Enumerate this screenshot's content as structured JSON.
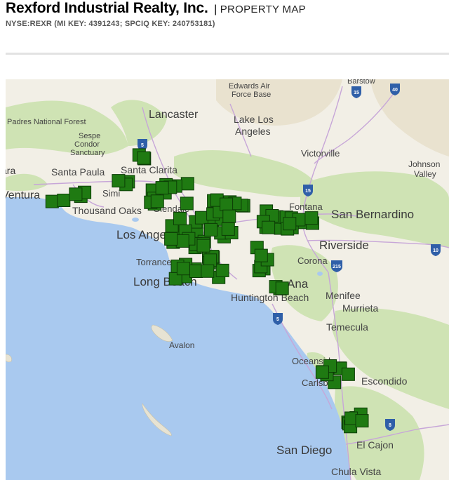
{
  "header": {
    "company_name": "Rexford Industrial Realty, Inc.",
    "separator": "|",
    "page_type": "PROPERTY MAP",
    "keys": "NYSE:REXR (MI KEY: 4391243; SPCIQ KEY: 240753181)"
  },
  "map": {
    "colors": {
      "land": "#f2efe6",
      "water": "#a9c9ef",
      "green": "#cfe3b4",
      "road": "#c7a6d8",
      "marker": "#1f7a12",
      "marker_stroke": "#0c3d06"
    },
    "places": [
      {
        "name": "Edwards Air",
        "kind": "minor"
      },
      {
        "name": "Force Base",
        "kind": "minor"
      },
      {
        "name": "Barstow",
        "kind": "minor"
      },
      {
        "name": "Lancaster",
        "kind": "city"
      },
      {
        "name": "Lake Los",
        "kind": "minor"
      },
      {
        "name": "Angeles",
        "kind": "minor"
      },
      {
        "name": "Padres National Forest",
        "kind": "minor"
      },
      {
        "name": "Sespe",
        "kind": "minor"
      },
      {
        "name": "Condor",
        "kind": "minor"
      },
      {
        "name": "Sanctuary",
        "kind": "minor"
      },
      {
        "name": "Victorville",
        "kind": "minor"
      },
      {
        "name": "Johnson",
        "kind": "minor"
      },
      {
        "name": "Valley",
        "kind": "minor"
      },
      {
        "name": "ara",
        "kind": "minor"
      },
      {
        "name": "Santa Paula",
        "kind": "minor"
      },
      {
        "name": "Santa Clarita",
        "kind": "minor"
      },
      {
        "name": "Ventura",
        "kind": "minor"
      },
      {
        "name": "Simi",
        "kind": "minor"
      },
      {
        "name": "Fontana",
        "kind": "minor"
      },
      {
        "name": "San Bernardino",
        "kind": "city"
      },
      {
        "name": "Thousand Oaks",
        "kind": "minor"
      },
      {
        "name": "Glendale",
        "kind": "minor"
      },
      {
        "name": "Los Angeles",
        "kind": "city"
      },
      {
        "name": "Riverside",
        "kind": "city"
      },
      {
        "name": "Torrance",
        "kind": "minor"
      },
      {
        "name": "Corona",
        "kind": "minor"
      },
      {
        "name": "Long Beach",
        "kind": "city"
      },
      {
        "name": "Ana",
        "kind": "city"
      },
      {
        "name": "Menifee",
        "kind": "minor"
      },
      {
        "name": "Huntington Beach",
        "kind": "minor"
      },
      {
        "name": "Murrieta",
        "kind": "minor"
      },
      {
        "name": "Temecula",
        "kind": "minor"
      },
      {
        "name": "Avalon",
        "kind": "minor"
      },
      {
        "name": "Oceanside",
        "kind": "minor"
      },
      {
        "name": "Carlsbad",
        "kind": "minor"
      },
      {
        "name": "Escondido",
        "kind": "minor"
      },
      {
        "name": "San Diego",
        "kind": "city"
      },
      {
        "name": "El Cajon",
        "kind": "minor"
      },
      {
        "name": "Chula Vista",
        "kind": "minor"
      }
    ],
    "shields": [
      {
        "number": "40",
        "type": "interstate"
      },
      {
        "number": "15",
        "type": "interstate"
      },
      {
        "number": "5",
        "type": "interstate"
      },
      {
        "number": "15",
        "type": "interstate"
      },
      {
        "number": "10",
        "type": "interstate"
      },
      {
        "number": "215",
        "type": "interstate"
      },
      {
        "number": "5",
        "type": "interstate"
      },
      {
        "number": "8",
        "type": "interstate"
      }
    ],
    "property_count": 120
  }
}
